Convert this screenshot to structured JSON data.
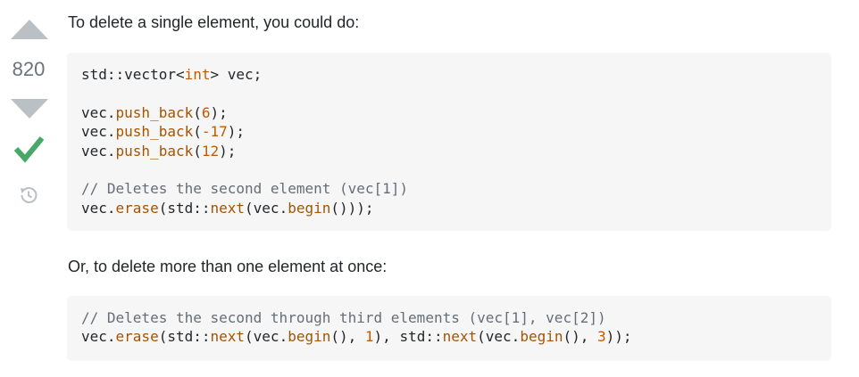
{
  "votes": {
    "score": "820",
    "upvote_icon": "triangle-up-icon",
    "downvote_icon": "triangle-down-icon",
    "accepted_icon": "checkmark-icon",
    "history_icon": "history-icon",
    "arrow_color": "#bbc0c4",
    "accepted_color": "#48a868"
  },
  "answer": {
    "paragraph_1": "To delete a single element, you could do:",
    "code_1": {
      "l1_a": "std::vector<",
      "l1_kw": "int",
      "l1_b": "> vec;",
      "l2_a": "vec.",
      "l2_fn": "push_back",
      "l2_b": "(",
      "l2_num": "6",
      "l2_c": ");",
      "l3_a": "vec.",
      "l3_fn": "push_back",
      "l3_b": "(",
      "l3_num": "-17",
      "l3_c": ");",
      "l4_a": "vec.",
      "l4_fn": "push_back",
      "l4_b": "(",
      "l4_num": "12",
      "l4_c": ");",
      "l5_comment": "// Deletes the second element (vec[1])",
      "l6_a": "vec.",
      "l6_fn1": "erase",
      "l6_b": "(std::",
      "l6_fn2": "next",
      "l6_c": "(vec.",
      "l6_fn3": "begin",
      "l6_d": "()));"
    },
    "paragraph_2": "Or, to delete more than one element at once:",
    "code_2": {
      "l1_comment": "// Deletes the second through third elements (vec[1], vec[2])",
      "l2_a": "vec.",
      "l2_fn1": "erase",
      "l2_b": "(std::",
      "l2_fn2": "next",
      "l2_c": "(vec.",
      "l2_fn3": "begin",
      "l2_d": "(), ",
      "l2_num1": "1",
      "l2_e": "), std::",
      "l2_fn4": "next",
      "l2_f": "(vec.",
      "l2_fn5": "begin",
      "l2_g": "(), ",
      "l2_num2": "3",
      "l2_h": "));"
    }
  }
}
